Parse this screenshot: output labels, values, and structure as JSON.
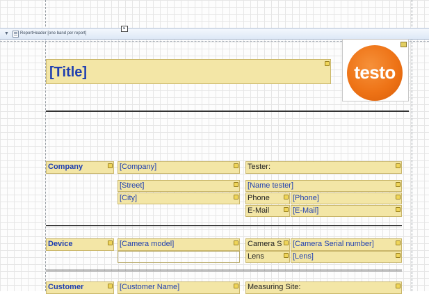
{
  "band": {
    "toggle": "▼",
    "label": "ReportHeader [one band per report]",
    "smart_tag": "▸"
  },
  "title": "[Title]",
  "logo": {
    "text": "testo",
    "color": "#ee7316"
  },
  "company": {
    "label": "Company",
    "name": "[Company]",
    "street": "[Street]",
    "city": "[City]"
  },
  "tester": {
    "label": "Tester:",
    "name": "[Name tester]",
    "phone_label": "Phone",
    "phone": "[Phone]",
    "email_label": "E-Mail",
    "email": "[E-Mail]"
  },
  "device": {
    "label": "Device",
    "camera_model": "[Camera model]",
    "serial_label": "Camera S",
    "serial": "[Camera Serial number]",
    "lens_label": "Lens",
    "lens": "[Lens]"
  },
  "customer": {
    "label": "Customer",
    "name": "[Customer Name]",
    "site_label": "Measuring Site:"
  },
  "colors": {
    "field_fill": "#f3e6a6",
    "expression_text": "#1f3fb0",
    "band_header": "#dde8f6"
  }
}
